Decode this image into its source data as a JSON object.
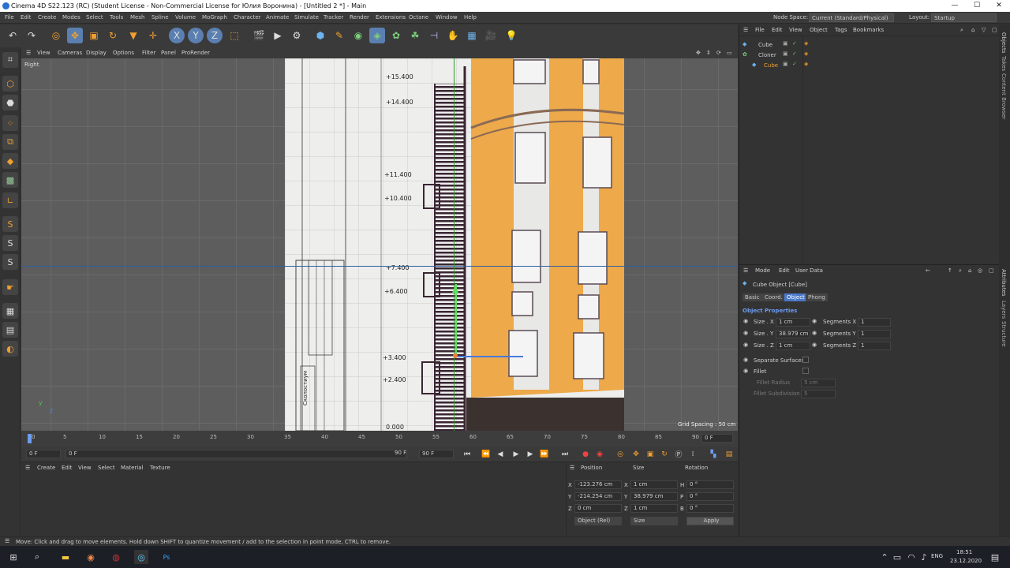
{
  "window": {
    "title": "Cinema 4D S22.123 (RC) (Student License - Non-Commercial License for Юлия Воронина) - [Untitled 2 *] - Main",
    "minimize": "—",
    "maximize": "☐",
    "close": "✕"
  },
  "menu": {
    "items": [
      "File",
      "Edit",
      "Create",
      "Modes",
      "Select",
      "Tools",
      "Mesh",
      "Spline",
      "Volume",
      "MoGraph",
      "Character",
      "Animate",
      "Simulate",
      "Tracker",
      "Render",
      "Extensions",
      "Octane",
      "Window",
      "Help"
    ],
    "node_space_label": "Node Space:",
    "node_space_value": "Current (Standard/Physical)",
    "layout_label": "Layout:",
    "layout_value": "Startup"
  },
  "viewport": {
    "menu": [
      "View",
      "Cameras",
      "Display",
      "Options",
      "Filter",
      "Panel",
      "ProRender"
    ],
    "camera_label": "Right",
    "grid_spacing": "Grid Spacing : 50 cm",
    "drawing_labels": [
      "+15.400",
      "+14.400",
      "+11.400",
      "+10.400",
      "+7.400",
      "+6.400",
      "+3.400",
      "+2.400",
      "0.000"
    ],
    "stamp_text": "Сколостиум"
  },
  "timeline": {
    "ticks": [
      "0",
      "5",
      "10",
      "15",
      "20",
      "25",
      "30",
      "35",
      "40",
      "45",
      "50",
      "55",
      "60",
      "65",
      "70",
      "75",
      "80",
      "85",
      "90"
    ],
    "current_frame": "0 F"
  },
  "playback": {
    "start": "0 F",
    "range_start": "0 F",
    "range_end": "90 F",
    "end": "90 F"
  },
  "materials": {
    "menu": [
      "Create",
      "Edit",
      "View",
      "Select",
      "Material",
      "Texture"
    ]
  },
  "coords": {
    "headers": [
      "Position",
      "Size",
      "Rotation"
    ],
    "rows": [
      {
        "axis": "X",
        "pos": "-123.276 cm",
        "size_axis": "X",
        "size": "1 cm",
        "rot_axis": "H",
        "rot": "0 °"
      },
      {
        "axis": "Y",
        "pos": "-214.254 cm",
        "size_axis": "Y",
        "size": "38.979 cm",
        "rot_axis": "P",
        "rot": "0 °"
      },
      {
        "axis": "Z",
        "pos": "0 cm",
        "size_axis": "Z",
        "size": "1 cm",
        "rot_axis": "B",
        "rot": "0 °"
      }
    ],
    "mode": "Object (Rel)",
    "size_mode": "Size",
    "apply": "Apply"
  },
  "objects": {
    "menu": [
      "File",
      "Edit",
      "View",
      "Object",
      "Tags",
      "Bookmarks"
    ],
    "items": [
      {
        "name": "Cube",
        "indent": 0
      },
      {
        "name": "Cloner",
        "indent": 0
      },
      {
        "name": "Cube",
        "indent": 1
      }
    ]
  },
  "attributes": {
    "menu": [
      "Mode",
      "Edit",
      "User Data"
    ],
    "object_title": "Cube Object [Cube]",
    "tabs": [
      "Basic",
      "Coord.",
      "Object",
      "Phong"
    ],
    "active_tab": "Object",
    "section": "Object Properties",
    "props": [
      {
        "label": "Size . X",
        "value": "1 cm",
        "seg_label": "Segments X",
        "seg_value": "1"
      },
      {
        "label": "Size . Y",
        "value": "38.979 cm",
        "seg_label": "Segments Y",
        "seg_value": "1"
      },
      {
        "label": "Size . Z",
        "value": "1 cm",
        "seg_label": "Segments Z",
        "seg_value": "1"
      }
    ],
    "separate_surfaces": "Separate Surfaces",
    "fillet": "Fillet",
    "fillet_radius": "Fillet Radius",
    "fillet_radius_value": "5 cm",
    "fillet_subdivision": "Fillet Subdivision",
    "fillet_subdivision_value": "5"
  },
  "right_strip": [
    "Objects",
    "Takes",
    "Content Browser",
    "Attributes",
    "Layers",
    "Structure"
  ],
  "status": "Move: Click and drag to move elements. Hold down SHIFT to quantize movement / add to the selection in point mode, CTRL to remove.",
  "taskbar": {
    "language": "ENG",
    "time": "18:51",
    "date": "23.12.2020"
  }
}
